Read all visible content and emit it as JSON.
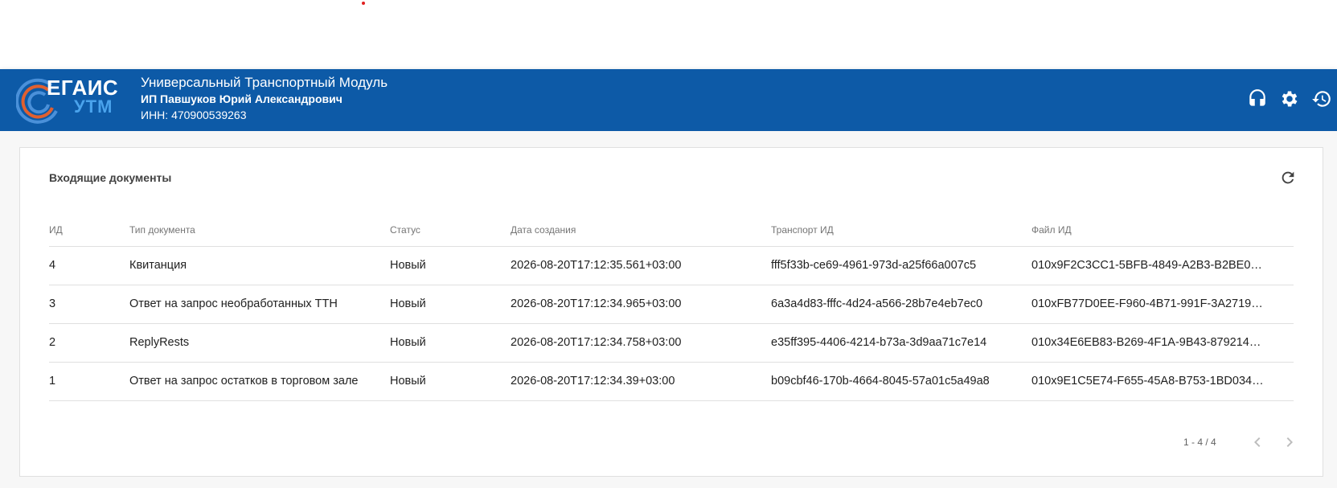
{
  "header": {
    "logo": {
      "line1": "ЕГАИС",
      "line2": "УТМ"
    },
    "title": "Универсальный Транспортный Модуль",
    "org": "ИП Павшуков Юрий Александрович",
    "inn": "ИНН: 470900539263",
    "icons": [
      "headset-icon",
      "gear-icon",
      "history-icon"
    ]
  },
  "card": {
    "title": "Входящие документы",
    "columns": [
      "ИД",
      "Тип документа",
      "Статус",
      "Дата создания",
      "Транспорт ИД",
      "Файл ИД"
    ],
    "rows": [
      [
        "4",
        "Квитанция",
        "Новый",
        "2026-08-20T17:12:35.561+03:00",
        "fff5f33b-ce69-4961-973d-a25f66a007c5",
        "010x9F2C3CC1-5BFB-4849-A2B3-B2BE0…"
      ],
      [
        "3",
        "Ответ на запрос необработанных ТТН",
        "Новый",
        "2026-08-20T17:12:34.965+03:00",
        "6a3a4d83-fffc-4d24-a566-28b7e4eb7ec0",
        "010xFB77D0EE-F960-4B71-991F-3A2719…"
      ],
      [
        "2",
        "ReplyRests",
        "Новый",
        "2026-08-20T17:12:34.758+03:00",
        "e35ff395-4406-4214-b73a-3d9aa71c7e14",
        "010x34E6EB83-B269-4F1A-9B43-879214…"
      ],
      [
        "1",
        "Ответ на запрос остатков в торговом зале",
        "Новый",
        "2026-08-20T17:12:34.39+03:00",
        "b09cbf46-170b-4664-8045-57a01c5a49a8",
        "010x9E1C5E74-F655-45A8-B753-1BD034…"
      ]
    ],
    "paginator": {
      "range": "1 - 4 / 4"
    }
  },
  "colors": {
    "header_bg": "#0d5aa7",
    "logo_accent": "#4aa3ec",
    "page_bg": "#f7f7f7"
  }
}
